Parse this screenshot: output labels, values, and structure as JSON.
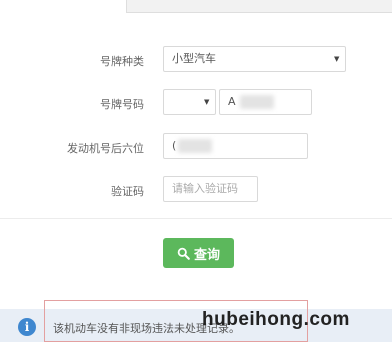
{
  "form": {
    "plate_type": {
      "label": "号牌种类",
      "value": "小型汽车"
    },
    "plate_number": {
      "label": "号牌号码",
      "prefix_value": "",
      "value_start": "A"
    },
    "engine_number": {
      "label": "发动机号后六位",
      "value_start": "("
    },
    "captcha": {
      "label": "验证码",
      "placeholder": "请输入验证码"
    }
  },
  "query_button": {
    "label": "查询"
  },
  "result_notice": {
    "text": "该机动车没有非现场违法未处理记录。"
  },
  "watermark": {
    "text": "hubeihong.com"
  },
  "colors": {
    "button": "#5cb85c",
    "info_icon": "#3f87cf",
    "notice_bg": "#e8eef6",
    "highlight_border": "#e3a0a0"
  },
  "icons": {
    "select_caret": "caret-down-icon",
    "search": "search-icon",
    "info": "info-icon"
  }
}
